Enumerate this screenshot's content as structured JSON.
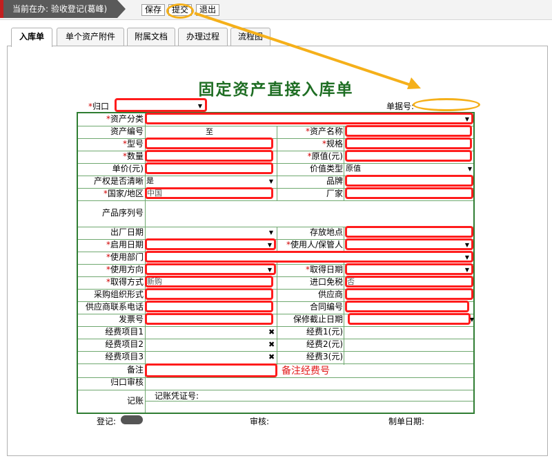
{
  "toolbar": {
    "breadcrumb": "当前在办: 验收登记(葛峰)",
    "save": "保存",
    "submit": "提交",
    "exit": "退出"
  },
  "tabs": [
    "入库单",
    "单个资产附件",
    "附属文档",
    "办理过程",
    "流程图"
  ],
  "form": {
    "title": "固定资产直接入库单",
    "guikou_label": "归口",
    "doc_no_label": "单据号:",
    "labels": {
      "asset_category": "资产分类",
      "asset_code": "资产编号",
      "asset_code_to": "至",
      "asset_name": "资产名称",
      "model": "型号",
      "spec": "规格",
      "quantity": "数量",
      "original_value": "原值(元)",
      "unit_price": "单价(元)",
      "value_type": "价值类型",
      "ownership_clear": "产权是否清晰",
      "brand": "品牌",
      "country": "国家/地区",
      "manufacturer": "厂家",
      "serial": "产品序列号",
      "factory_date": "出厂日期",
      "location": "存放地点",
      "start_date": "启用日期",
      "user": "使用人/保管人",
      "department": "使用部门",
      "usage_direction": "使用方向",
      "acquire_date": "取得日期",
      "acquire_method": "取得方式",
      "import_tax_free": "进口免税",
      "procurement_form": "采购组织形式",
      "supplier": "供应商",
      "supplier_phone": "供应商联系电话",
      "contract_no": "合同编号",
      "invoice_no": "发票号",
      "warranty_date": "保修截止日期",
      "fund1": "经费项目1",
      "fund1_amount": "经费1(元)",
      "fund2": "经费项目2",
      "fund2_amount": "经费2(元)",
      "fund3": "经费项目3",
      "fund3_amount": "经费3(元)",
      "remark": "备注",
      "guikou_review": "归口审核",
      "bookkeeping": "记账",
      "voucher_no": "记账凭证号:"
    },
    "values": {
      "value_type": "原值",
      "ownership_clear": "是",
      "country": "中国",
      "acquire_method": "新购",
      "import_tax_free": "否"
    },
    "remark_annotation": "备注经费号"
  },
  "footer": {
    "register": "登记:",
    "review": "审核:",
    "date": "制单日期:"
  },
  "colors": {
    "title_green": "#1f6e24",
    "annotation_red": "#ff1c1c",
    "callout_orange": "#f5b01a"
  }
}
